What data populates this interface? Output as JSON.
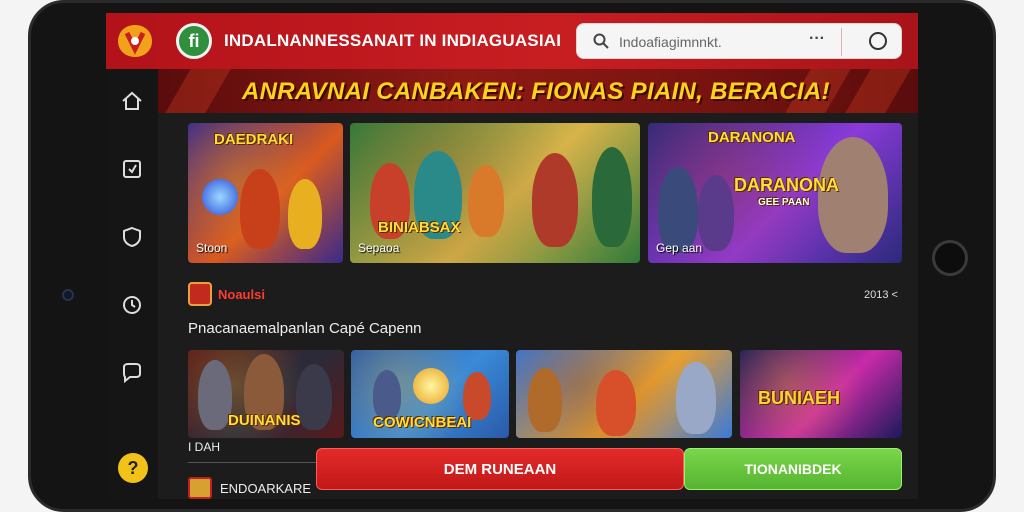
{
  "header": {
    "app_badge": "fi",
    "title": "INDALNANNESSANAIT IN INDIAGUASIAI",
    "search": {
      "placeholder": "Indoafiagimnnkt.",
      "more": "···"
    }
  },
  "banner": {
    "text": "ANRAVNAI CANBAKEN: FIONAS PIAIN, BERACIA!"
  },
  "sidebar": {
    "items": [
      {
        "icon": "home-icon"
      },
      {
        "icon": "library-icon"
      },
      {
        "icon": "shield-icon"
      },
      {
        "icon": "clock-icon"
      },
      {
        "icon": "chat-icon"
      }
    ],
    "help_label": "?"
  },
  "featured": [
    {
      "title": "DAEDRAKI",
      "subtitle": "",
      "caption": "Stoon",
      "colors": [
        "#3a2a8a",
        "#d85a20",
        "#f2a21a"
      ]
    },
    {
      "title": "BINIABSAX",
      "subtitle": "",
      "caption": "Sepaoa",
      "colors": [
        "#2f7a3a",
        "#d8b34a",
        "#8a5a2a"
      ]
    },
    {
      "title": "DARANONA",
      "subtitle": "GEE PAAN",
      "caption": "Gep aan",
      "colors": [
        "#2a2a7a",
        "#8a3ad8",
        "#c83a3a"
      ]
    }
  ],
  "section": {
    "label": "Noaulsi",
    "meta": "2013 <"
  },
  "subheading": "Pnacanaemalpanlan Capé Capenn",
  "games": [
    {
      "title": "DUINANIS",
      "colors": [
        "#5a1a1a",
        "#2a2a3a",
        "#c8a030"
      ]
    },
    {
      "title": "COWICNBEAI",
      "colors": [
        "#2a5aa8",
        "#3a8ad8",
        "#e8c040"
      ]
    },
    {
      "title": "",
      "colors": [
        "#3a7ad8",
        "#e8a030",
        "#8a3a1a"
      ]
    },
    {
      "title": "BUNIAEH",
      "colors": [
        "#1a1a5a",
        "#c82aa8",
        "#f2b21a"
      ]
    }
  ],
  "small_caption": "I DAH",
  "bottom_label": "ENDOARKARE",
  "actions": {
    "primary": "DEM RUNEAAN",
    "secondary": "TIONANIBDEK"
  }
}
